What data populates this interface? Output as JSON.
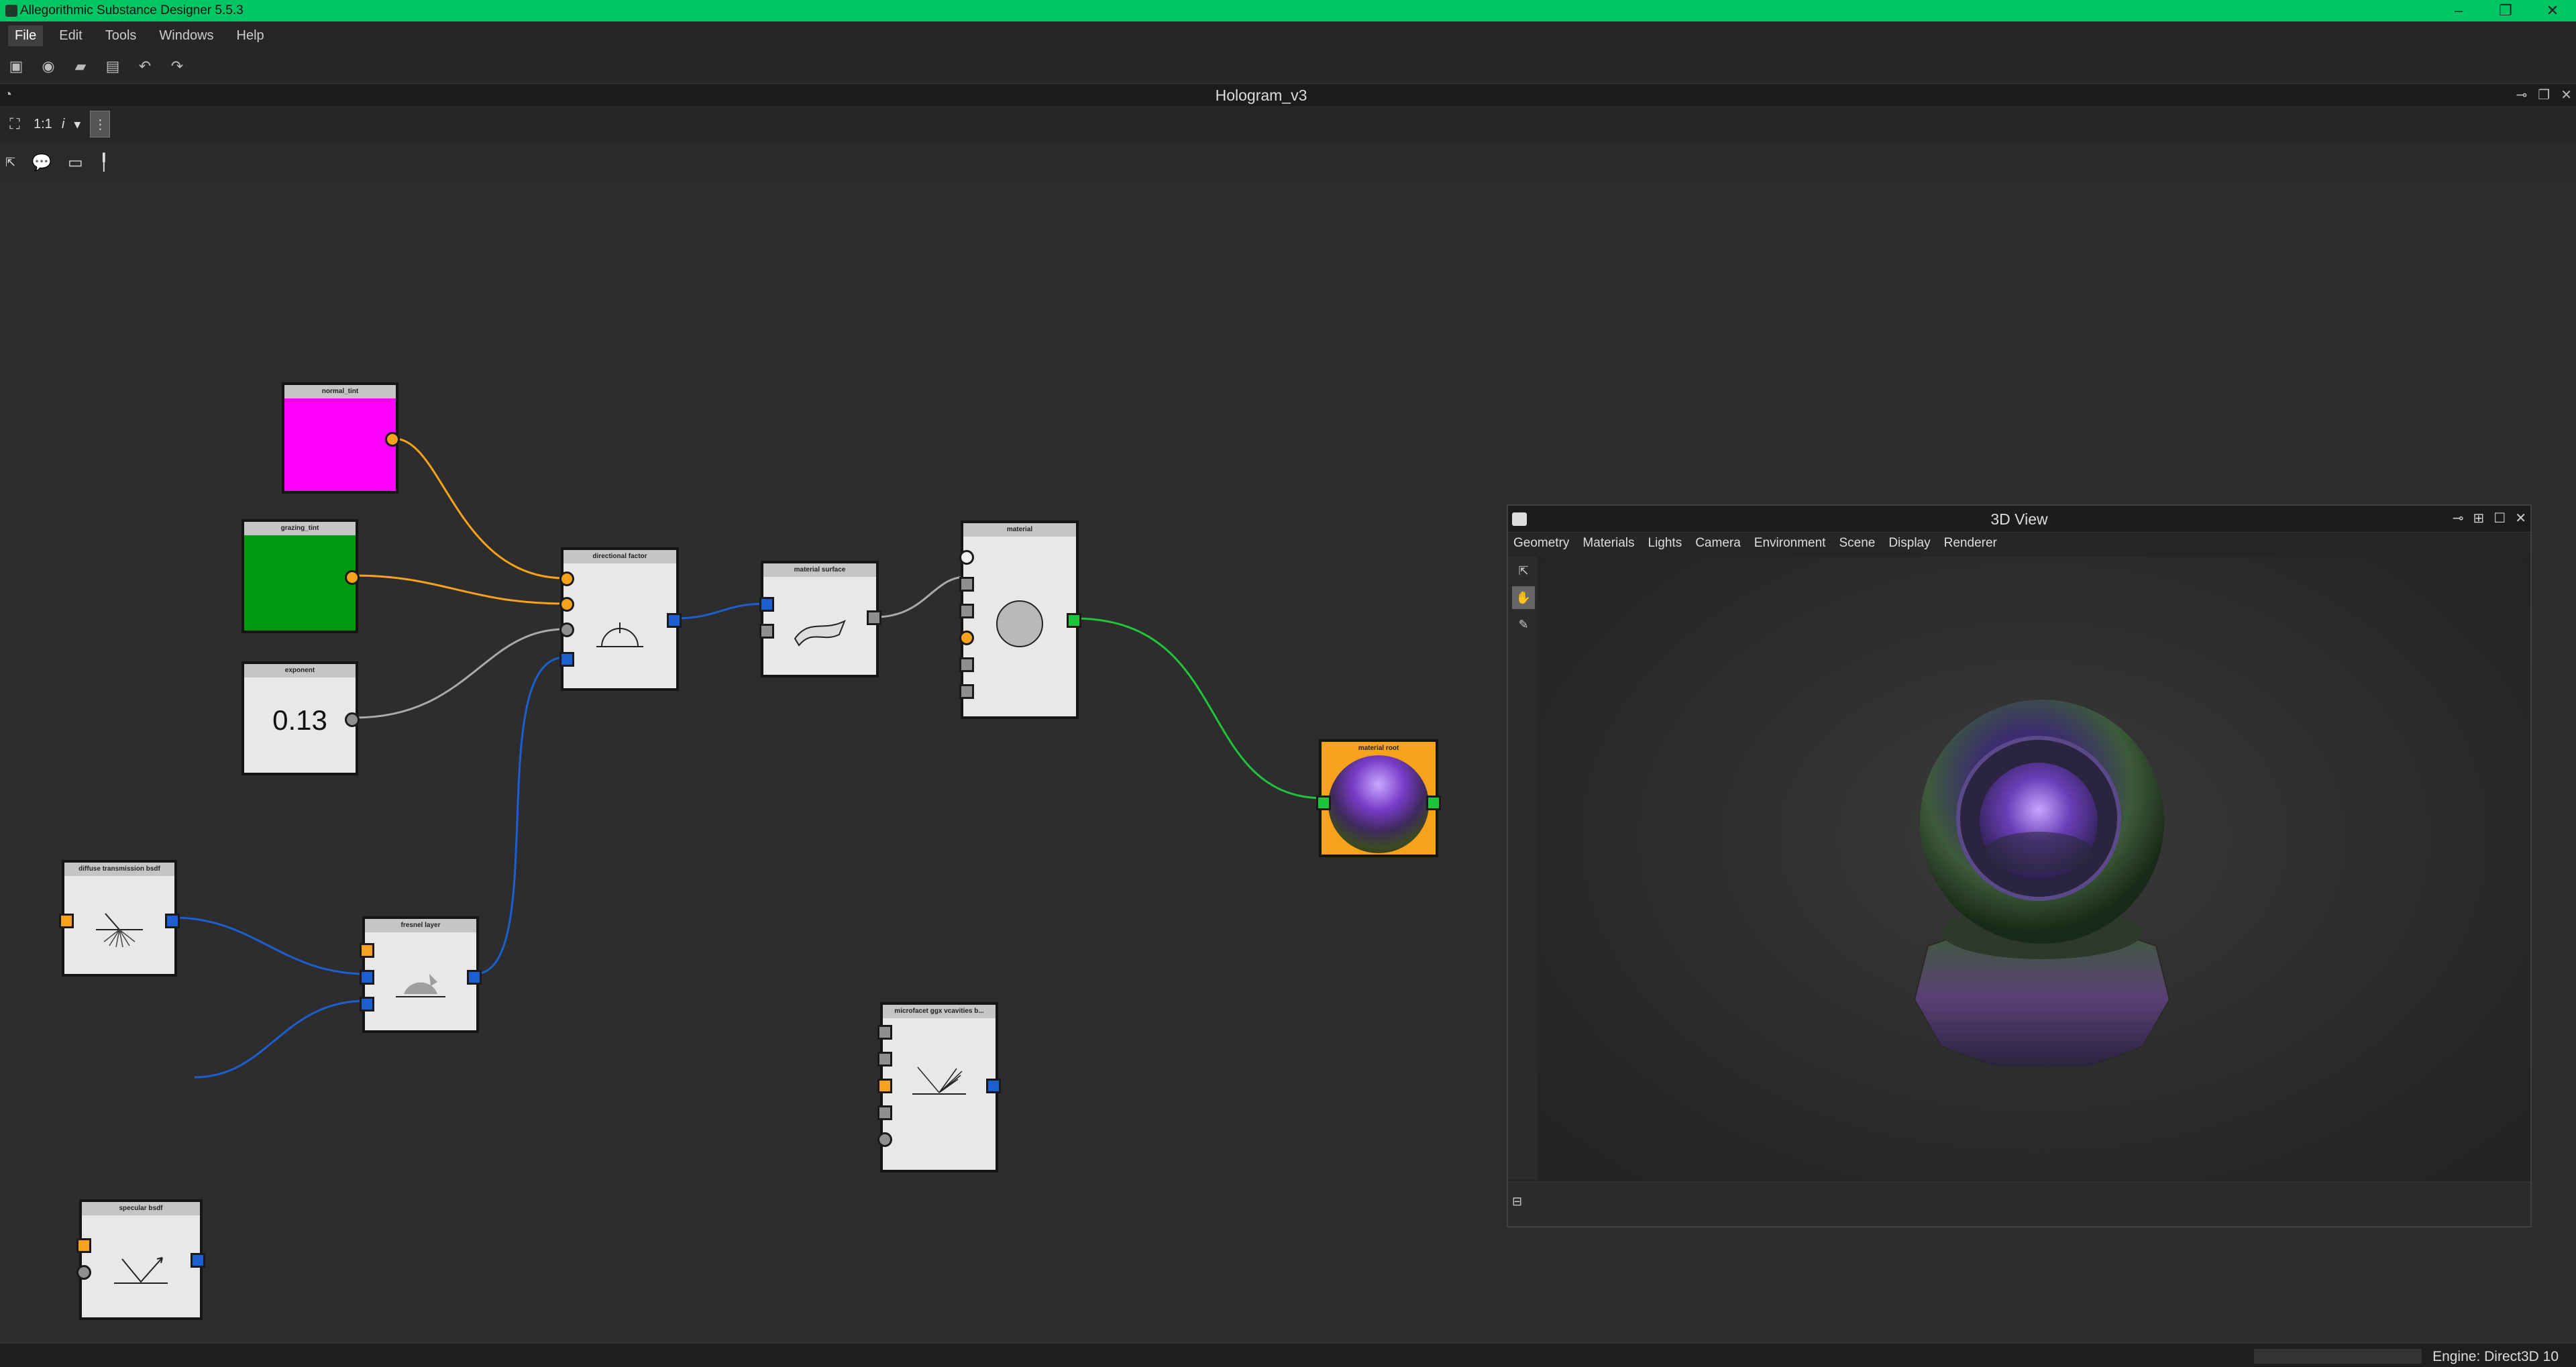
{
  "app": {
    "title": "Allegorithmic Substance Designer 5.5.3"
  },
  "window_controls": {
    "minimize": "–",
    "restore": "❐",
    "close": "✕"
  },
  "menu": [
    "File",
    "Edit",
    "Tools",
    "Windows",
    "Help"
  ],
  "graph": {
    "title": "Hologram_v3",
    "zoom_label": "1:1",
    "info_label": "i",
    "nodes": {
      "normal_tint": "normal_tint",
      "grazing_tint": "grazing_tint",
      "exponent": "exponent",
      "exponent_value": "0.13",
      "directional_factor": "directional factor",
      "material_surface": "material surface",
      "material": "material",
      "material_root": "material root",
      "diffuse_transmission": "diffuse transmission bsdf",
      "specular_bsdf": "specular bsdf",
      "fresnel_layer": "fresnel layer",
      "microfacet": "microfacet ggx vcavities b..."
    },
    "colors": {
      "normal_tint": "#ff00ff",
      "grazing_tint": "#00990f"
    }
  },
  "view3d": {
    "title": "3D View",
    "menu": [
      "Geometry",
      "Materials",
      "Lights",
      "Camera",
      "Environment",
      "Scene",
      "Display",
      "Renderer"
    ]
  },
  "status": {
    "engine": "Engine: Direct3D 10"
  }
}
